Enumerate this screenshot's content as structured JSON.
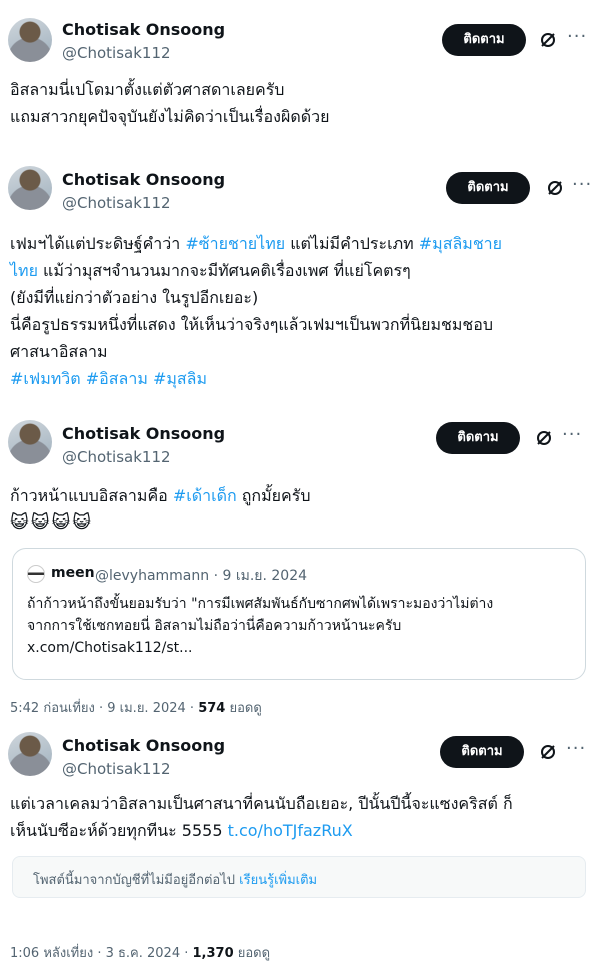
{
  "follow_label": "ติดตาม",
  "tweets": [
    {
      "name": "Chotisak Onsoong",
      "handle": "@Chotisak112",
      "text": "อิสลามนี่เปโดมาตั้งแต่ตัวศาสดาเลยครับ\nแถมสาวกยุคปัจจุบันยังไม่คิดว่าเป็นเรื่องผิดด้วย"
    },
    {
      "name": "Chotisak Onsoong",
      "handle": "@Chotisak112",
      "text_1": "เฟมฯได้แต่ประดิษฐ์คำว่า ",
      "tag_1": "#ซ้ายชายไทย",
      "text_2": " แต่ไม่มีคำประเภท ",
      "tag_2": "#มุสลิมชาย\nไทย",
      "text_3": " แม้ว่ามุสฯจำนวนมากจะมีทัศนคติเรื่องเพศ ที่แย่โคตรๆ\n(ยังมีที่แย่กว่าตัวอย่าง ในรูปอีกเยอะ)\nนี่คือรูปธรรมหนึ่งที่แสดง ให้เห็นว่าจริงๆแล้วเฟมฯเป็นพวกที่นิยมชมชอบ\nศาสนาอิสลาม\n",
      "hashtags": "#เฟมทวิต #อิสลาม #มุสลิม"
    },
    {
      "name": "Chotisak Onsoong",
      "handle": "@Chotisak112",
      "text_1": "ก้าวหน้าแบบอิสลามคือ ",
      "tag_1": "#เด้าเด็ก",
      "text_2": " ถูกมั้ยครับ",
      "emojis": "😺😺😺😺",
      "quote": {
        "name": "meen",
        "handle": "@levyhammann · 9 เม.ย. 2024",
        "text": "ถ้าก้าวหน้าถึงขั้นยอมรับว่า \"การมีเพศสัมพันธ์กับซากศพได้เพราะมองว่าไม่ต่าง\nจากการใช้เซกทอยนี่ อิสลามไม่ถือว่านี่คือความก้าวหน้านะครับ\nx.com/Chotisak112/st..."
      },
      "meta_time": "5:42 ก่อนเที่ยง · 9 เม.ย. 2024 · ",
      "meta_views": "574",
      "meta_views_label": " ยอดดู"
    },
    {
      "name": "Chotisak Onsoong",
      "handle": "@Chotisak112",
      "text_1": "แต่เวลาเคลมว่าอิสลามเป็นศาสนาที่คนนับถือเยอะ, ปีนั้นปีนี้จะแซงคริสต์ ก็\nเห็นนับซีอะห์ด้วยทุกทีนะ 5555 ",
      "link": "t.co/hoTJfazRuX",
      "notice_text": "โพสต์นี้มาจากบัญชีที่ไม่มีอยู่อีกต่อไป ",
      "notice_link": "เรียนรู้เพิ่มเติม",
      "meta_time": "1:06 หลังเที่ยง · 3 ธ.ค. 2024 · ",
      "meta_views": "1,370",
      "meta_views_label": " ยอดดู"
    }
  ],
  "icons": {
    "grok": "grok-icon",
    "more": "more-icon"
  },
  "colors": {
    "link": "#1d9bf0",
    "button": "#0f1419",
    "muted": "#536471"
  }
}
